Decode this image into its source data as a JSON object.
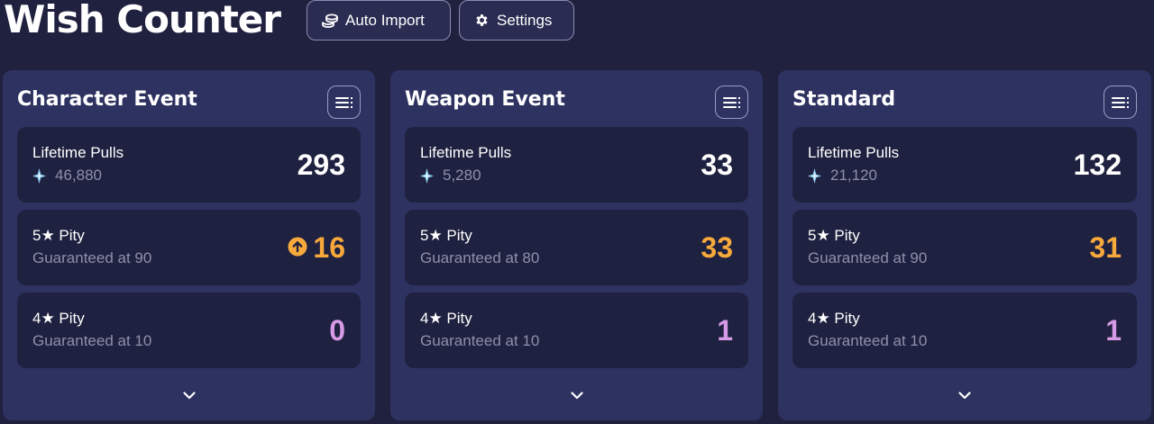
{
  "header": {
    "title": "Wish Counter",
    "auto_import_label": "Auto Import",
    "settings_label": "Settings"
  },
  "panels": [
    {
      "title": "Character Event",
      "lifetime": {
        "label": "Lifetime Pulls",
        "primogems": "46,880",
        "value": "293"
      },
      "five_star": {
        "label": "5★ Pity",
        "sub": "Guaranteed at 90",
        "value": "16",
        "icon": "arrow-up-circle-icon"
      },
      "four_star": {
        "label": "4★ Pity",
        "sub": "Guaranteed at 10",
        "value": "0"
      }
    },
    {
      "title": "Weapon Event",
      "lifetime": {
        "label": "Lifetime Pulls",
        "primogems": "5,280",
        "value": "33"
      },
      "five_star": {
        "label": "5★ Pity",
        "sub": "Guaranteed at 80",
        "value": "33"
      },
      "four_star": {
        "label": "4★ Pity",
        "sub": "Guaranteed at 10",
        "value": "1"
      }
    },
    {
      "title": "Standard",
      "lifetime": {
        "label": "Lifetime Pulls",
        "primogems": "21,120",
        "value": "132"
      },
      "five_star": {
        "label": "5★ Pity",
        "sub": "Guaranteed at 90",
        "value": "31"
      },
      "four_star": {
        "label": "4★ Pity",
        "sub": "Guaranteed at 10",
        "value": "1"
      }
    }
  ],
  "icons": {
    "auto_import": "coins-stack-icon",
    "settings": "gear-icon",
    "menu": "list-menu-icon",
    "primogem": "primogem-sparkle-icon",
    "expand": "chevron-down-icon"
  },
  "colors": {
    "background": "#20213f",
    "panel": "#2e3260",
    "card": "#1f2140",
    "five_star_accent": "#f7a93c",
    "four_star_accent": "#d79ae6",
    "muted_text": "#8d8fab"
  }
}
